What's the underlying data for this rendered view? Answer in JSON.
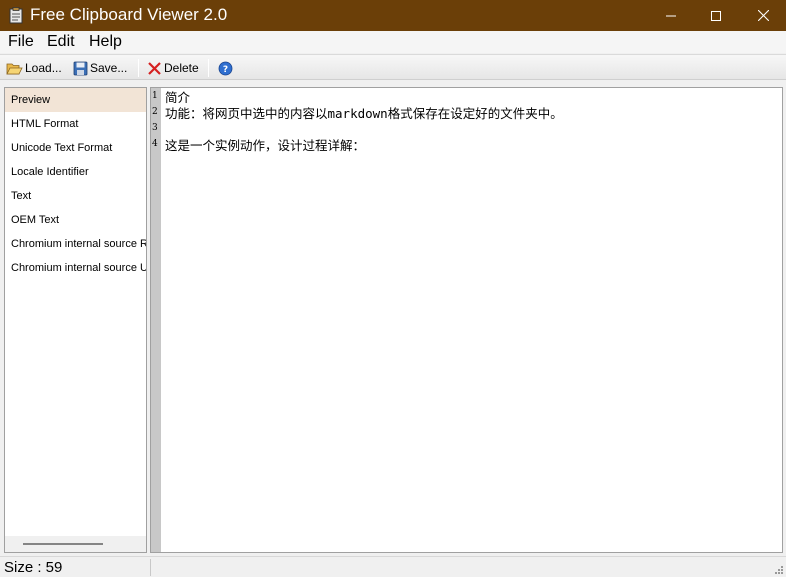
{
  "window": {
    "title": "Free Clipboard Viewer 2.0",
    "title_bar_color": "#6b3f08",
    "icon": "clipboard-app-icon",
    "controls": [
      "minimize-icon",
      "maximize-icon",
      "close-icon"
    ]
  },
  "menu": {
    "file": "File",
    "edit": "Edit",
    "help": "Help"
  },
  "toolbar": {
    "load": "Load...",
    "save": "Save...",
    "delete": "Delete",
    "help_icon": "help-icon"
  },
  "formats": [
    "Preview",
    "HTML Format",
    "Unicode Text Format",
    "Locale Identifier",
    "Text",
    "OEM Text",
    "Chromium internal source RFH token",
    "Chromium internal source URL"
  ],
  "selected_format": "Preview",
  "selection_color": "#f2e4d6",
  "editor": {
    "line_numbers": [
      "1",
      "2",
      "3",
      "4"
    ],
    "lines": [
      "简介",
      "功能：将网页中选中的内容以markdown格式保存在设定好的文件夹中。",
      "",
      "这是一个实例动作，设计过程详解："
    ]
  },
  "status": {
    "size": "Size : 59"
  }
}
